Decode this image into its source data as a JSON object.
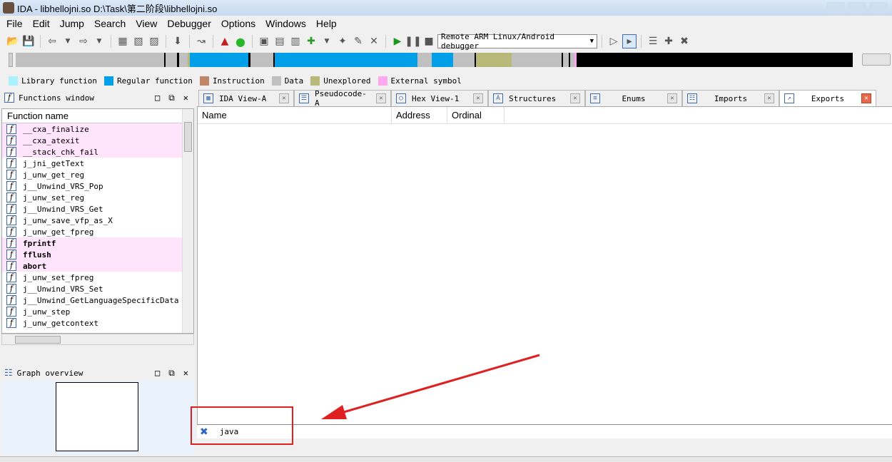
{
  "window": {
    "title": "IDA - libhellojni.so D:\\Task\\第二阶段\\libhellojni.so"
  },
  "menu": [
    "File",
    "Edit",
    "Jump",
    "Search",
    "View",
    "Debugger",
    "Options",
    "Windows",
    "Help"
  ],
  "toolbar": {
    "debugger_select": "Remote ARM Linux/Android debugger"
  },
  "legend": [
    {
      "label": "Library function",
      "color": "#aaf0ff"
    },
    {
      "label": "Regular function",
      "color": "#00a0e8"
    },
    {
      "label": "Instruction",
      "color": "#c0856a"
    },
    {
      "label": "Data",
      "color": "#c0c0c0"
    },
    {
      "label": "Unexplored",
      "color": "#b8b878"
    },
    {
      "label": "External symbol",
      "color": "#ffa8f0"
    }
  ],
  "functions_window": {
    "title": "Functions window",
    "column": "Function name",
    "items": [
      {
        "name": "__cxa_finalize",
        "type": "external"
      },
      {
        "name": "__cxa_atexit",
        "type": "external"
      },
      {
        "name": "__stack_chk_fail",
        "type": "external"
      },
      {
        "name": "j_jni_getText",
        "type": "regular"
      },
      {
        "name": "j_unw_get_reg",
        "type": "regular"
      },
      {
        "name": "j__Unwind_VRS_Pop",
        "type": "regular"
      },
      {
        "name": "j_unw_set_reg",
        "type": "regular"
      },
      {
        "name": "j__Unwind_VRS_Get",
        "type": "regular"
      },
      {
        "name": "j_unw_save_vfp_as_X",
        "type": "regular"
      },
      {
        "name": "j_unw_get_fpreg",
        "type": "regular"
      },
      {
        "name": "fprintf",
        "type": "external-bold"
      },
      {
        "name": "fflush",
        "type": "external-bold"
      },
      {
        "name": "abort",
        "type": "external-bold"
      },
      {
        "name": "j_unw_set_fpreg",
        "type": "regular"
      },
      {
        "name": "j__Unwind_VRS_Set",
        "type": "regular"
      },
      {
        "name": "j__Unwind_GetLanguageSpecificData",
        "type": "regular"
      },
      {
        "name": "j_unw_step",
        "type": "regular"
      },
      {
        "name": "j_unw_getcontext",
        "type": "regular"
      }
    ]
  },
  "graph_overview": {
    "title": "Graph overview"
  },
  "tabs": [
    {
      "label": "IDA View-A",
      "icon": "ida-view-icon"
    },
    {
      "label": "Pseudocode-A",
      "icon": "pseudocode-icon"
    },
    {
      "label": "Hex View-1",
      "icon": "hex-view-icon"
    },
    {
      "label": "Structures",
      "icon": "structures-icon"
    },
    {
      "label": "Enums",
      "icon": "enums-icon"
    },
    {
      "label": "Imports",
      "icon": "imports-icon"
    },
    {
      "label": "Exports",
      "icon": "exports-icon",
      "active": true
    }
  ],
  "exports": {
    "columns": [
      "Name",
      "Address",
      "Ordinal"
    ]
  },
  "filter": {
    "text": "java"
  }
}
